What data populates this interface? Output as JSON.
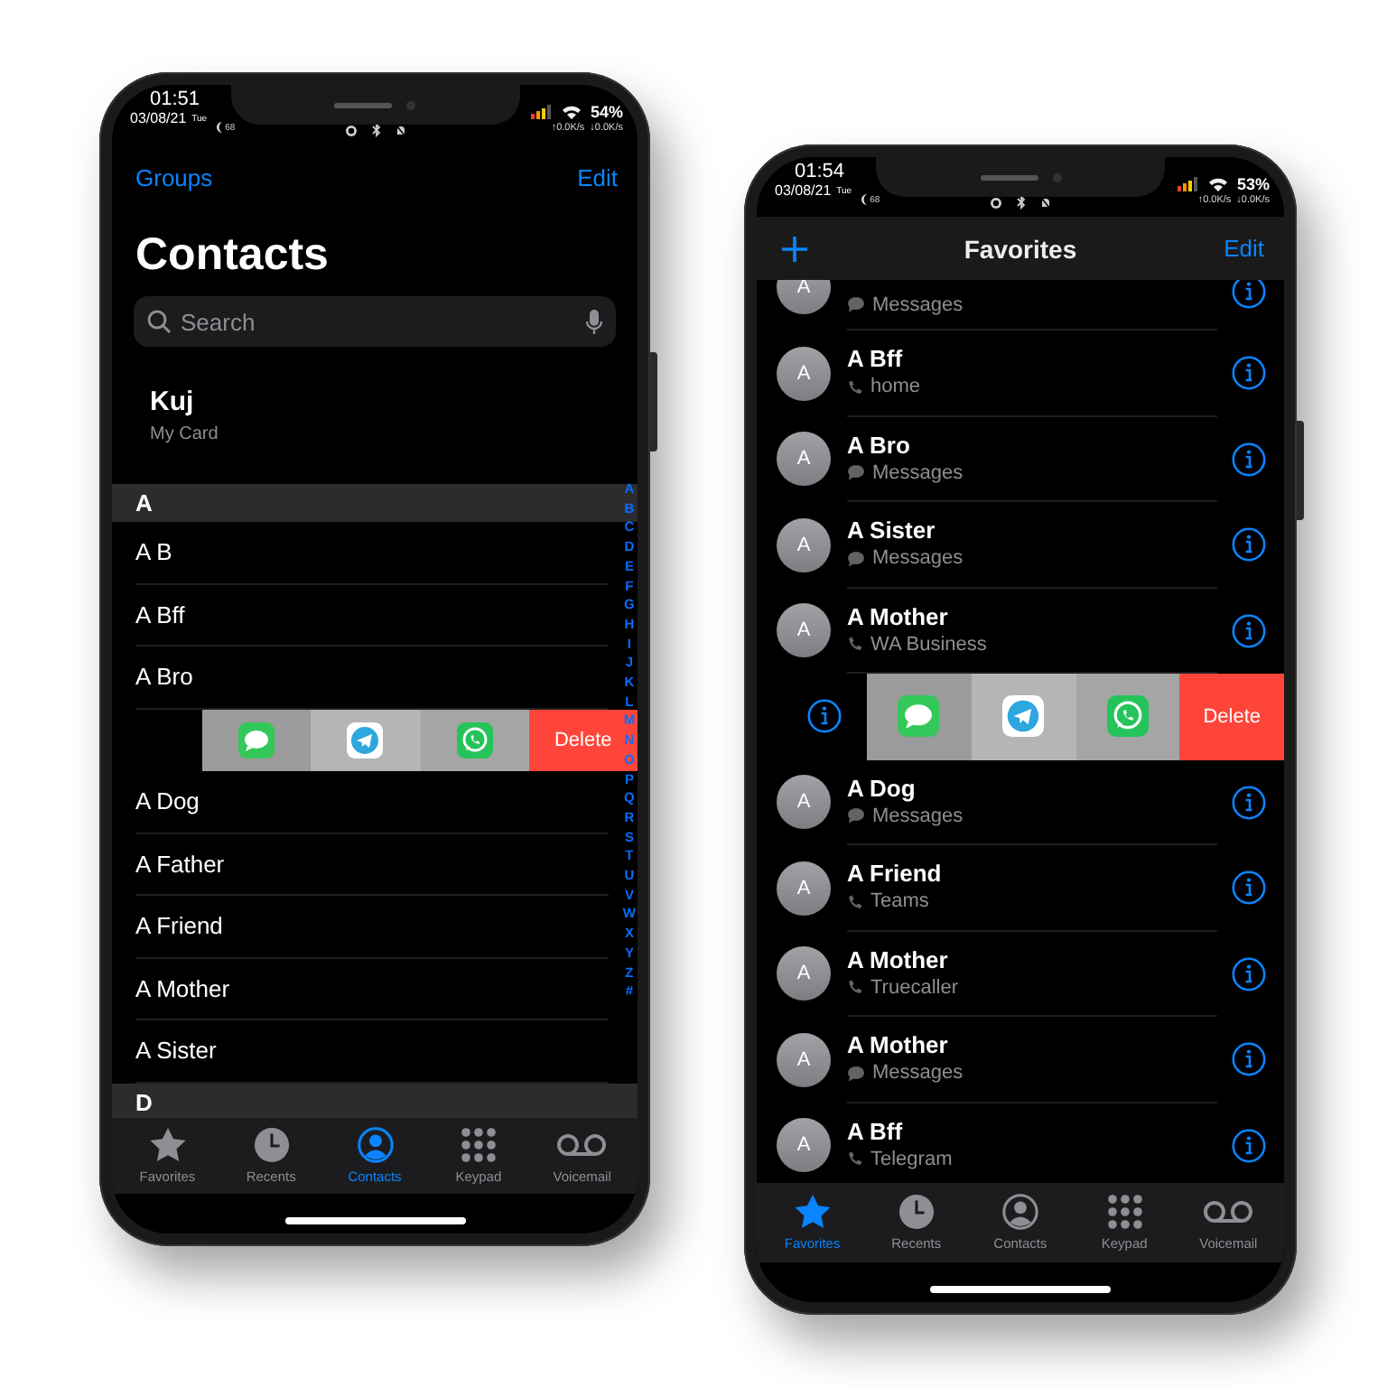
{
  "phones": [
    {
      "kind": "contacts",
      "status_bar": {
        "time": "01:51",
        "date": "03/08/21",
        "day": "Tue",
        "badge": "68",
        "battery": "54%",
        "upload": "↑0.0K/s",
        "download": "↓0.0K/s"
      },
      "nav": {
        "left": "Groups",
        "right": "Edit"
      },
      "title": "Contacts",
      "search": {
        "placeholder": "Search"
      },
      "my_card": {
        "name": "Kuj",
        "label": "My Card"
      },
      "sections": [
        {
          "letter": "A",
          "rows": [
            {
              "kind": "contact",
              "name": "A B"
            },
            {
              "kind": "contact",
              "name": "A Bff"
            },
            {
              "kind": "contact",
              "name": "A Bro"
            },
            {
              "kind": "swiped",
              "actions": [
                {
                  "kind": "messages"
                },
                {
                  "kind": "telegram"
                },
                {
                  "kind": "whatsapp"
                },
                {
                  "kind": "delete",
                  "label": "Delete"
                }
              ]
            },
            {
              "kind": "contact",
              "name": "A Dog"
            },
            {
              "kind": "contact",
              "name": "A Father"
            },
            {
              "kind": "contact",
              "name": "A Friend"
            },
            {
              "kind": "contact",
              "name": "A Mother"
            },
            {
              "kind": "contact",
              "name": "A Sister"
            }
          ]
        },
        {
          "letter": "D"
        }
      ],
      "index": [
        "A",
        "B",
        "C",
        "D",
        "E",
        "F",
        "G",
        "H",
        "I",
        "J",
        "K",
        "L",
        "M",
        "N",
        "O",
        "P",
        "Q",
        "R",
        "S",
        "T",
        "U",
        "V",
        "W",
        "X",
        "Y",
        "Z",
        "#"
      ],
      "tabs": [
        {
          "kind": "star",
          "label": "Favorites",
          "selected": false
        },
        {
          "kind": "clock",
          "label": "Recents",
          "selected": false
        },
        {
          "kind": "person",
          "label": "Contacts",
          "selected": true
        },
        {
          "kind": "keypad",
          "label": "Keypad",
          "selected": false
        },
        {
          "kind": "voicemail",
          "label": "Voicemail",
          "selected": false
        }
      ]
    },
    {
      "kind": "favorites",
      "status_bar": {
        "time": "01:54",
        "date": "03/08/21",
        "day": "Tue",
        "badge": "68",
        "battery": "53%",
        "upload": "↑0.0K/s",
        "download": "↓0.0K/s"
      },
      "nav": {
        "right": "Edit"
      },
      "title": "Favorites",
      "favorites": [
        {
          "kind": "contact",
          "initial": "A",
          "detail": {
            "kind": "message",
            "text": "Messages"
          }
        },
        {
          "kind": "contact",
          "initial": "A",
          "name": "A Bff",
          "detail": {
            "kind": "phone",
            "text": "home"
          }
        },
        {
          "kind": "contact",
          "initial": "A",
          "name": "A Bro",
          "detail": {
            "kind": "message",
            "text": "Messages"
          }
        },
        {
          "kind": "contact",
          "initial": "A",
          "name": "A Sister",
          "detail": {
            "kind": "message",
            "text": "Messages"
          }
        },
        {
          "kind": "contact",
          "initial": "A",
          "name": "A Mother",
          "detail": {
            "kind": "phone",
            "text": "WA Business"
          }
        },
        {
          "kind": "swiped",
          "actions": [
            {
              "kind": "messages"
            },
            {
              "kind": "telegram"
            },
            {
              "kind": "whatsapp"
            },
            {
              "kind": "delete",
              "label": "Delete"
            }
          ]
        },
        {
          "kind": "contact",
          "initial": "A",
          "name": "A Dog",
          "detail": {
            "kind": "message",
            "text": "Messages"
          }
        },
        {
          "kind": "contact",
          "initial": "A",
          "name": "A Friend",
          "detail": {
            "kind": "phone",
            "text": "Teams"
          }
        },
        {
          "kind": "contact",
          "initial": "A",
          "name": "A Mother",
          "detail": {
            "kind": "phone",
            "text": "Truecaller"
          }
        },
        {
          "kind": "contact",
          "initial": "A",
          "name": "A Mother",
          "detail": {
            "kind": "message",
            "text": "Messages"
          }
        },
        {
          "kind": "contact",
          "initial": "A",
          "name": "A Bff",
          "detail": {
            "kind": "phone",
            "text": "Telegram"
          }
        }
      ],
      "tabs": [
        {
          "kind": "star",
          "label": "Favorites",
          "selected": true
        },
        {
          "kind": "clock",
          "label": "Recents",
          "selected": false
        },
        {
          "kind": "person",
          "label": "Contacts",
          "selected": false
        },
        {
          "kind": "keypad",
          "label": "Keypad",
          "selected": false
        },
        {
          "kind": "voicemail",
          "label": "Voicemail",
          "selected": false
        }
      ]
    }
  ]
}
